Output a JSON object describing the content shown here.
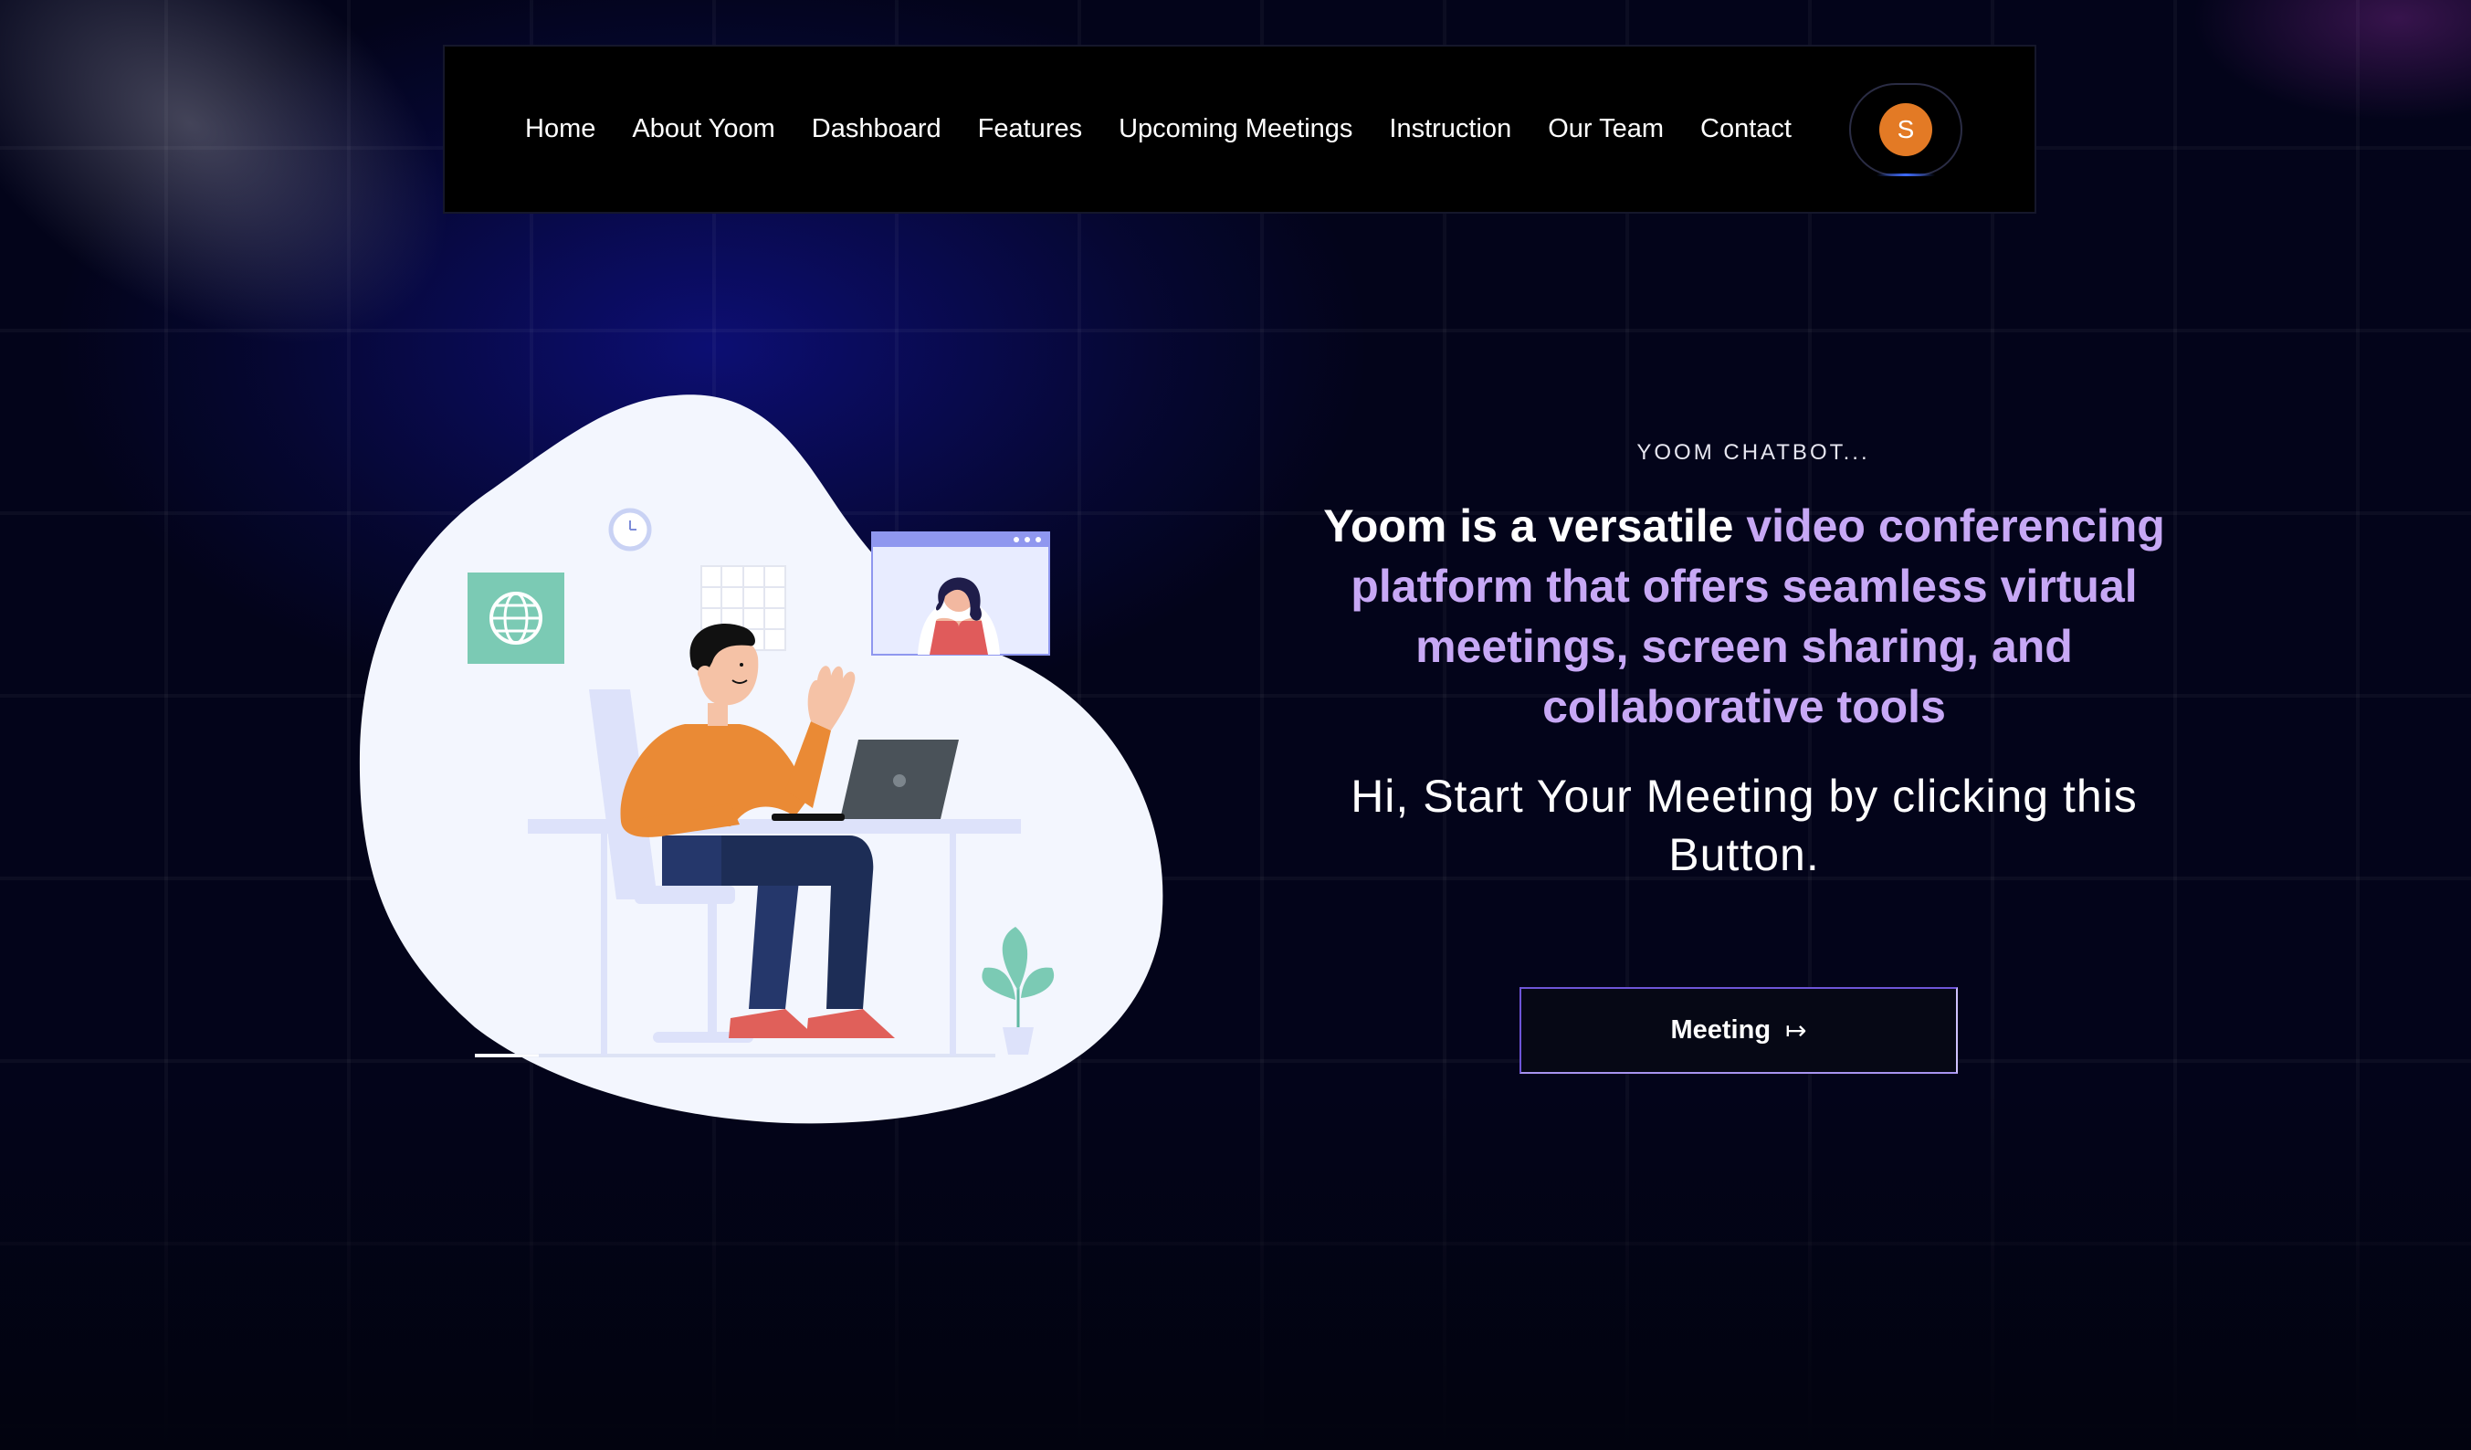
{
  "nav": {
    "links": [
      "Home",
      "About Yoom",
      "Dashboard",
      "Features",
      "Upcoming Meetings",
      "Instruction",
      "Our Team",
      "Contact"
    ],
    "avatar_initial": "S"
  },
  "hero": {
    "eyebrow": "YOOM CHATBOT...",
    "headline_white": "Yoom is a versatile ",
    "headline_purple": "video conferencing platform that offers seamless virtual meetings, screen sharing, and collaborative tools",
    "subline": "Hi, Start Your Meeting by clicking this Button.",
    "button_label": "Meeting",
    "button_icon": "arrow-right-icon"
  },
  "colors": {
    "background": "#03041a",
    "accent_purple": "#c7a8f5",
    "avatar": "#e37a25",
    "button_border": "#6e55d8"
  }
}
